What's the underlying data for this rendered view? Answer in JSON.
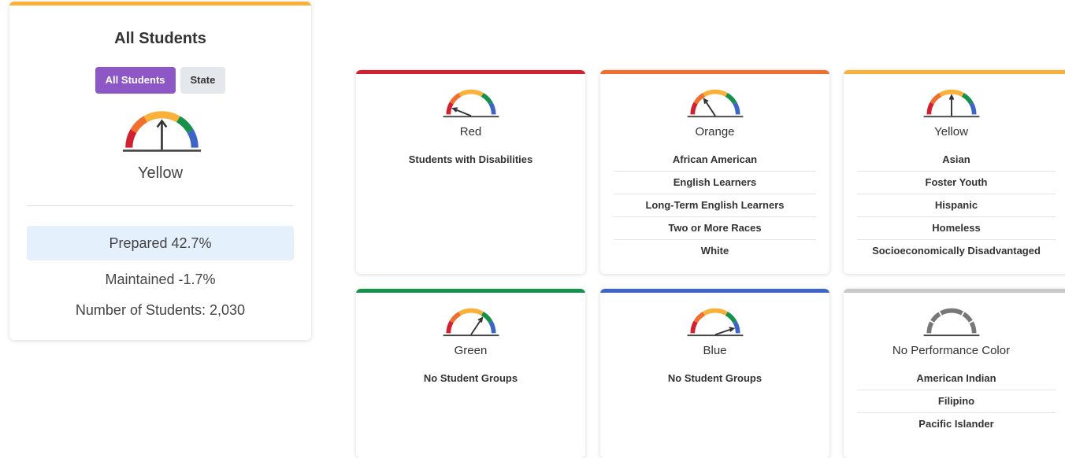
{
  "main": {
    "title": "All Students",
    "toggle_all": "All Students",
    "toggle_state": "State",
    "level": "Yellow",
    "prepared": "Prepared 42.7%",
    "maintained": "Maintained -1.7%",
    "count": "Number of Students: 2,030",
    "accent": "#f9b13a"
  },
  "colors": {
    "red": "#d1202f",
    "orange": "#f26e2c",
    "yellow": "#f9b13a",
    "green": "#16914a",
    "blue": "#3b66c7",
    "gray": "#c8c8c8"
  },
  "groups": [
    {
      "label": "Red",
      "students": [
        "Students with Disabilities"
      ]
    },
    {
      "label": "Orange",
      "students": [
        "African American",
        "English Learners",
        "Long-Term English Learners",
        "Two or More Races",
        "White"
      ]
    },
    {
      "label": "Yellow",
      "students": [
        "Asian",
        "Foster Youth",
        "Hispanic",
        "Homeless",
        "Socioeconomically Disadvantaged"
      ]
    },
    {
      "label": "Green",
      "students": [
        "No Student Groups"
      ]
    },
    {
      "label": "Blue",
      "students": [
        "No Student Groups"
      ]
    },
    {
      "label": "No Performance Color",
      "students": [
        "American Indian",
        "Filipino",
        "Pacific Islander"
      ]
    }
  ]
}
